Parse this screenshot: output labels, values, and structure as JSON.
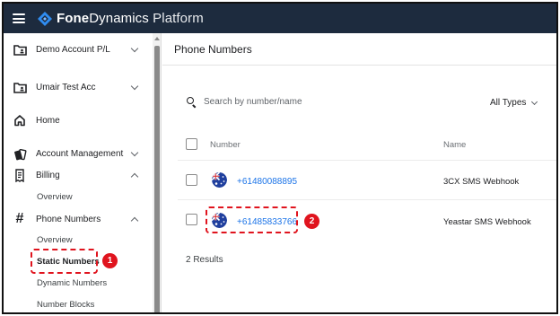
{
  "topbar": {
    "brand_bold": "Fone",
    "brand_rest": "Dynamics",
    "brand_light": "Platform"
  },
  "sidebar": {
    "items": [
      {
        "label": "Demo Account P/L",
        "icon": "folder-account-icon",
        "chevron": "down"
      },
      {
        "label": "Umair Test Acc",
        "icon": "folder-account-icon",
        "chevron": "down"
      },
      {
        "label": "Home",
        "icon": "home-icon"
      },
      {
        "label": "Account Management",
        "icon": "cards-icon",
        "chevron": "down"
      },
      {
        "label": "Billing",
        "icon": "receipt-icon",
        "chevron": "up"
      },
      {
        "label": "Phone Numbers",
        "icon": "hash-icon",
        "chevron": "up"
      }
    ],
    "billing_sub": [
      "Overview"
    ],
    "phone_sub": [
      "Overview",
      "Static Numbers",
      "Dynamic Numbers",
      "Number Blocks"
    ],
    "active_sub": "Static Numbers"
  },
  "annotations": {
    "badge_1": "1",
    "badge_2": "2",
    "highlight_color": "#e0141e"
  },
  "main": {
    "title": "Phone Numbers",
    "search_placeholder": "Search by number/name",
    "type_filter": "All Types",
    "columns": {
      "number": "Number",
      "name": "Name"
    },
    "rows": [
      {
        "number": "+61480088895",
        "name": "3CX SMS Webhook",
        "flag": "australia-flag-icon"
      },
      {
        "number": "+61485833766",
        "name": "Yeastar SMS Webhook",
        "flag": "australia-flag-icon"
      }
    ],
    "results": "2 Results"
  },
  "colors": {
    "topbar": "#1d2b3e",
    "link": "#1a73e8",
    "accent_logo": "#2f8cf0"
  }
}
